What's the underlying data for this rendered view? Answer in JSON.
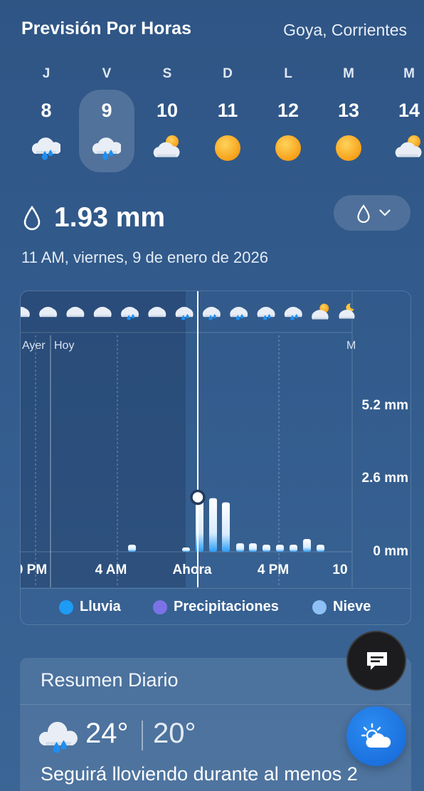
{
  "header": {
    "title": "Previsión Por Horas",
    "location": "Goya, Corrientes"
  },
  "days": [
    {
      "letter": "J",
      "num": "8",
      "icon": "rain-cloud-icon"
    },
    {
      "letter": "V",
      "num": "9",
      "icon": "rain-cloud-icon",
      "selected": true
    },
    {
      "letter": "S",
      "num": "10",
      "icon": "partly-cloudy-icon"
    },
    {
      "letter": "D",
      "num": "11",
      "icon": "sun-icon"
    },
    {
      "letter": "L",
      "num": "12",
      "icon": "sun-icon"
    },
    {
      "letter": "M",
      "num": "13",
      "icon": "sun-icon"
    },
    {
      "letter": "M",
      "num": "14",
      "icon": "partly-cloudy-icon"
    }
  ],
  "precip": {
    "value": "1.93 mm",
    "datetime": "11 AM, viernes, 9 de enero de 2026"
  },
  "chart_data": {
    "type": "bar",
    "ylabels": [
      "5.2 mm",
      "2.6 mm",
      "0 mm"
    ],
    "ylim": [
      0,
      6.2
    ],
    "day_labels": [
      "Ayer",
      "Hoy",
      "M"
    ],
    "xticks": [
      "0 PM",
      "4 AM",
      "Ahora",
      "4 PM",
      "10"
    ],
    "now_label": "Ahora",
    "current_value": 1.93,
    "series": [
      {
        "name": "Lluvia",
        "color": "#2b9df5",
        "values": [
          0.25,
          0,
          0,
          0,
          0,
          0,
          0,
          0,
          0,
          0,
          0,
          0.15,
          1.93,
          1.9,
          1.75,
          0.3,
          0.3,
          0.25,
          0.25,
          0.25,
          0.45,
          0.25
        ]
      }
    ],
    "icons": [
      "cloud",
      "cloud",
      "cloud",
      "cloud",
      "rain",
      "cloud",
      "rain",
      "rain",
      "rain",
      "rain",
      "rain",
      "sun-cloud",
      "moon-cloud"
    ]
  },
  "legend": [
    {
      "label": "Lluvia",
      "color": "#1e9bf5"
    },
    {
      "label": "Precipitaciones",
      "color": "#7b72e6"
    },
    {
      "label": "Nieve",
      "color": "#8ec0f5"
    }
  ],
  "summary": {
    "title": "Resumen Diario",
    "high": "24°",
    "low": "20°",
    "text": "Seguirá lloviendo durante al menos 2"
  }
}
